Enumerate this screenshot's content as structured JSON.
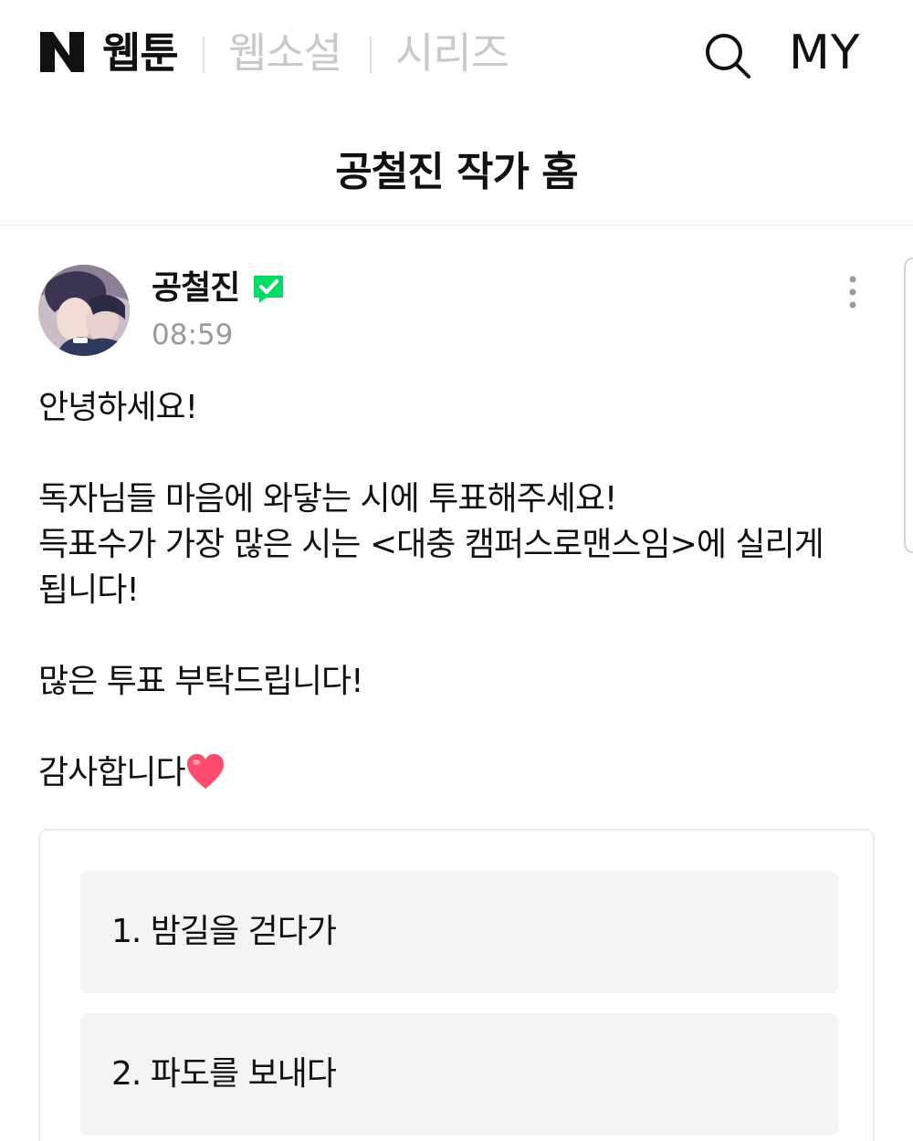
{
  "nav": {
    "logo_text": "N",
    "tabs": [
      {
        "label": "웹툰",
        "active": true
      },
      {
        "label": "웹소설",
        "active": false
      },
      {
        "label": "시리즈",
        "active": false
      }
    ],
    "search_icon": "search-icon",
    "my_label": "MY"
  },
  "page": {
    "title": "공철진 작가 홈"
  },
  "post": {
    "author": "공철진",
    "verified_icon": "verified-check-icon",
    "time": "08:59",
    "more_icon": "more-vertical-icon",
    "lines": {
      "greeting": "안녕하세요!",
      "l1": "독자님들 마음에 와닿는 시에 투표해주세요!",
      "l2": "득표수가 가장 많은 시는 <대충 캠퍼스로맨스임>에 실리게",
      "l3": "됩니다!",
      "l4": "많은 투표 부탁드립니다!",
      "l5": "감사합니다"
    },
    "heart_icon": "heart-emoji-icon"
  },
  "poll": {
    "options": [
      {
        "label": "1. 밤길을 걷다가"
      },
      {
        "label": "2. 파도를 보내다"
      }
    ]
  },
  "colors": {
    "verified": "#00dc64",
    "muted_text": "#9a9a9a",
    "inactive_tab": "#c9c9c9",
    "option_bg": "#f4f4f4",
    "heart": "#ff4b6e"
  }
}
